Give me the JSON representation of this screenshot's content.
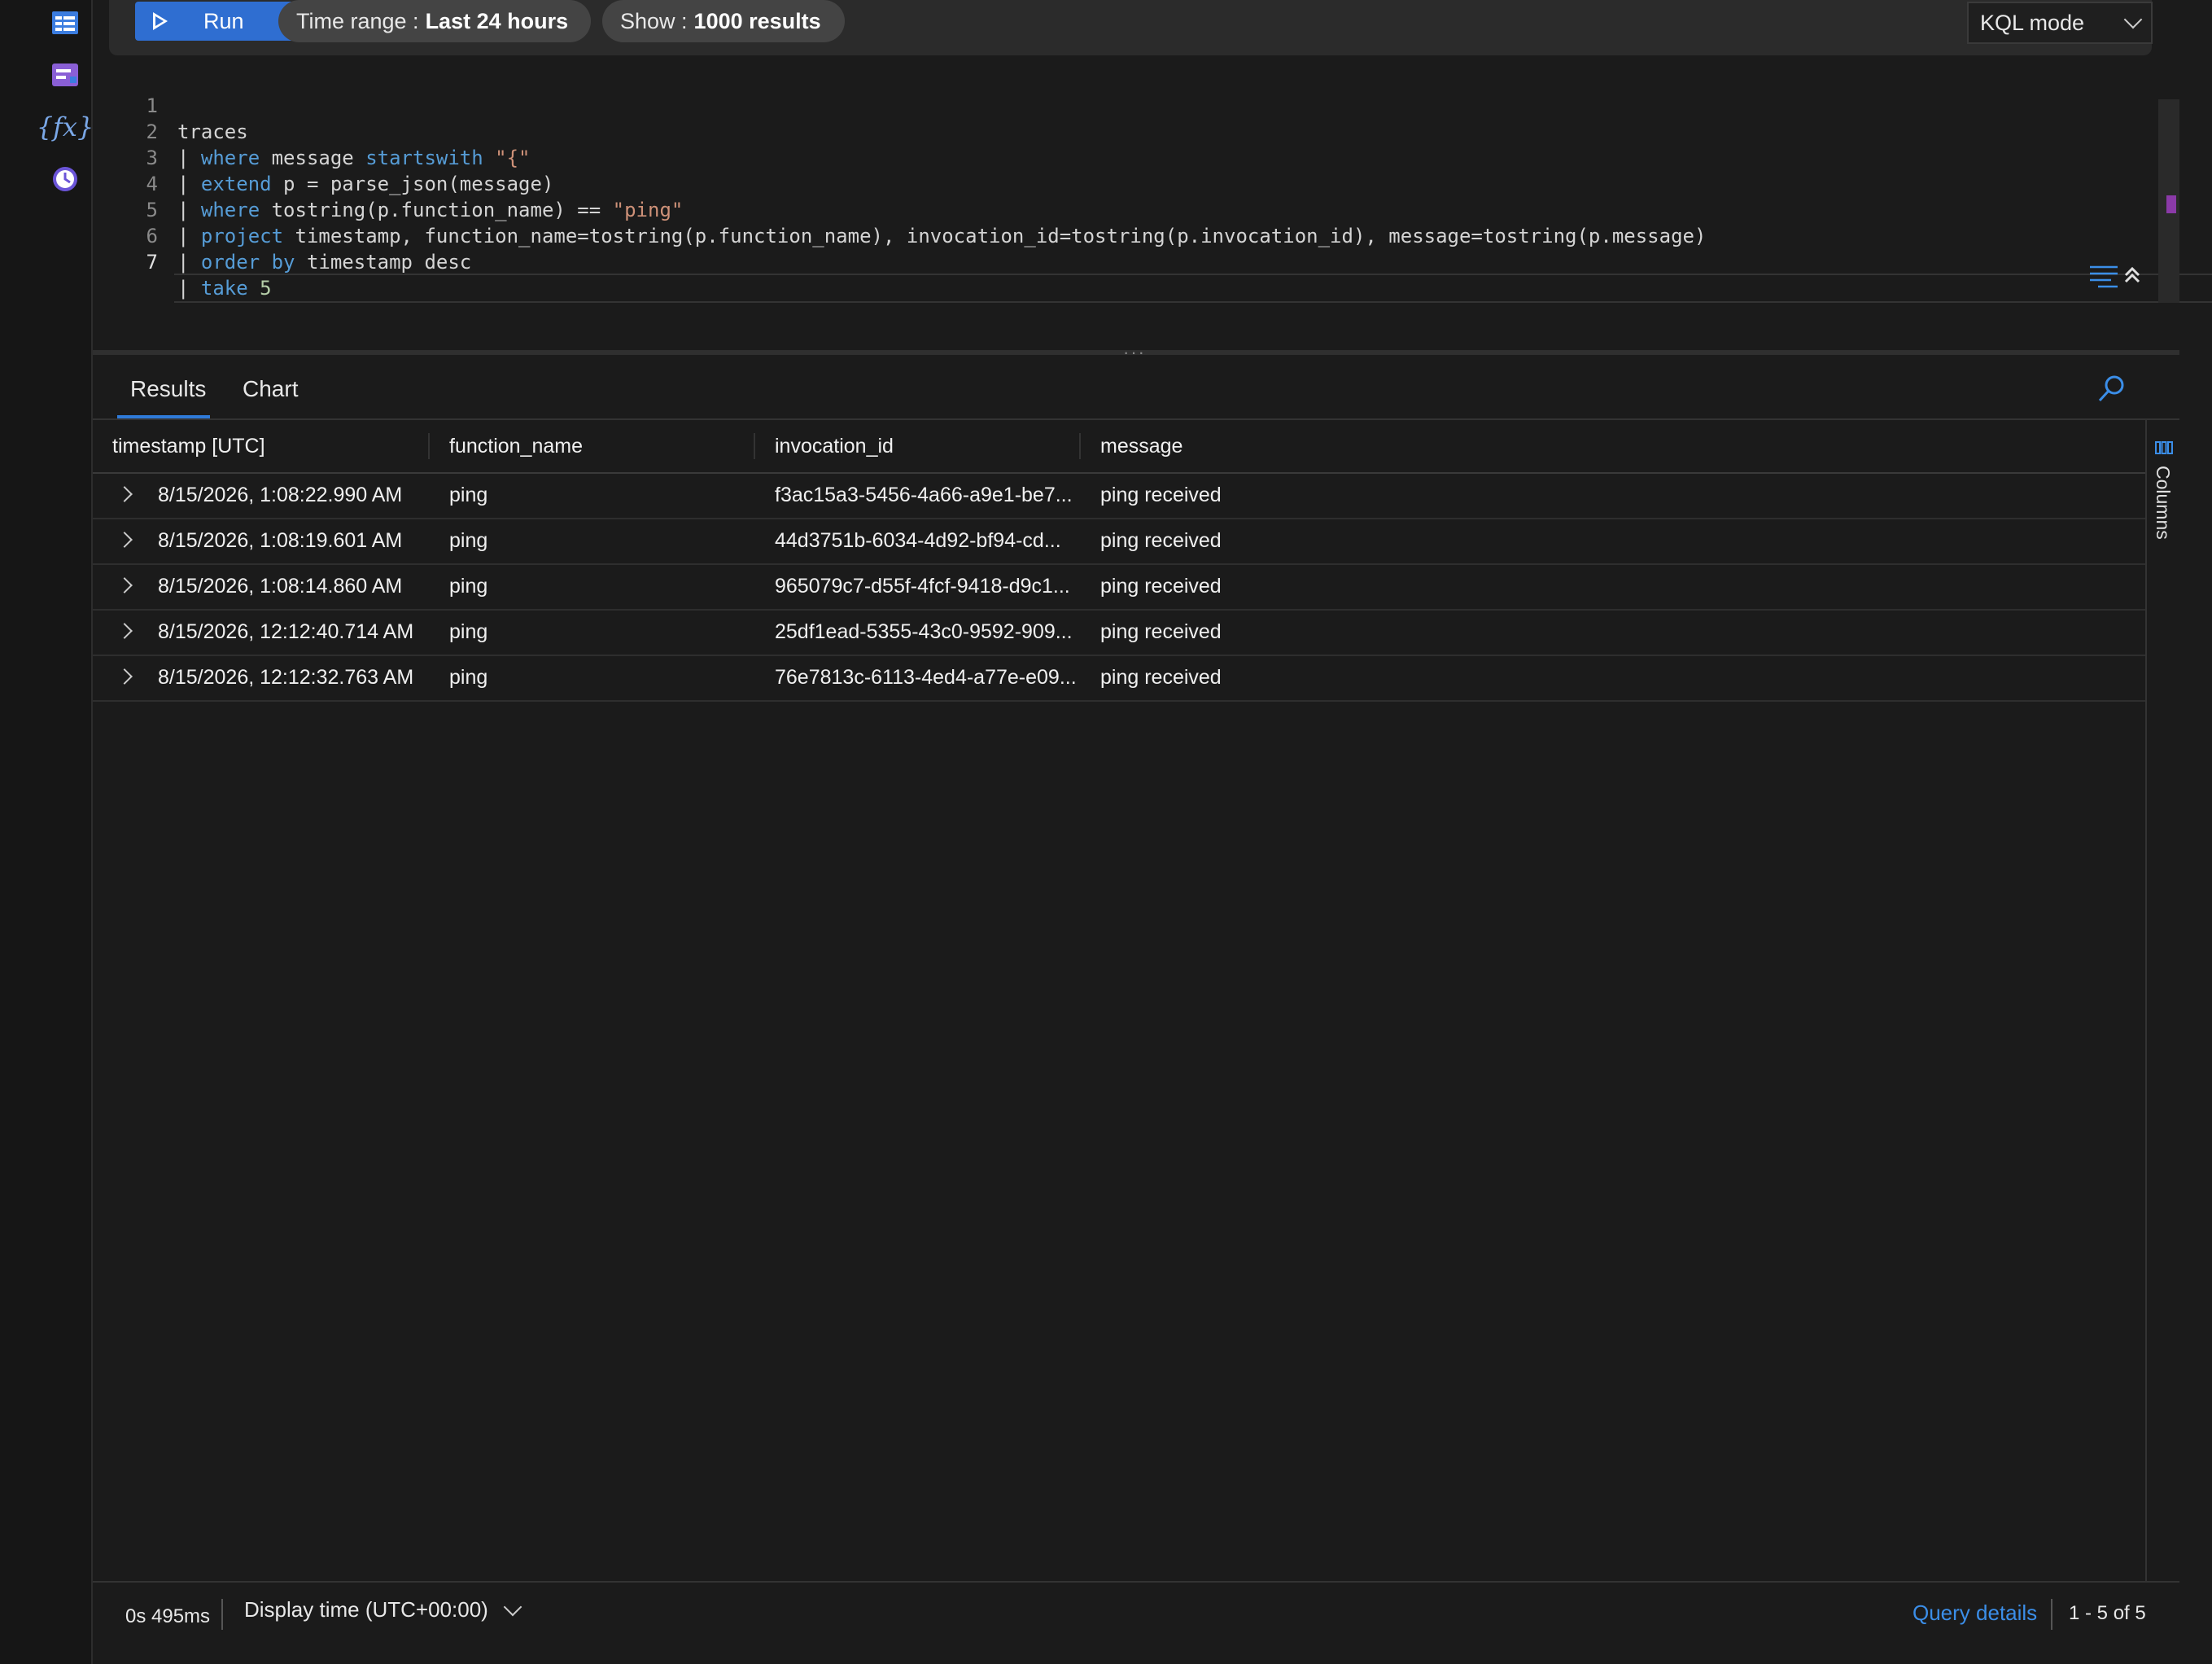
{
  "rail": {
    "icons": [
      "tables-icon",
      "queries-icon",
      "functions-icon",
      "history-icon"
    ],
    "fx_glyph": "{fx}"
  },
  "toolbar": {
    "run_label": "Run",
    "time_range_label": "Time range :",
    "time_range_value": "Last 24 hours",
    "show_label": "Show :",
    "show_value": "1000 results",
    "mode_label": "KQL mode"
  },
  "editor": {
    "active_line": 7,
    "lines": [
      {
        "n": "1",
        "text": "traces"
      },
      {
        "n": "2",
        "text": "| where message startswith \"{\""
      },
      {
        "n": "3",
        "text": "| extend p = parse_json(message)"
      },
      {
        "n": "4",
        "text": "| where tostring(p.function_name) == \"ping\""
      },
      {
        "n": "5",
        "text": "| project timestamp, function_name=tostring(p.function_name), invocation_id=tostring(p.invocation_id), message=tostring(p.message)"
      },
      {
        "n": "6",
        "text": "| order by timestamp desc"
      },
      {
        "n": "7",
        "text": "| take 5"
      }
    ]
  },
  "tabs": {
    "results": "Results",
    "chart": "Chart"
  },
  "grid": {
    "columns": [
      "timestamp [UTC]",
      "function_name",
      "invocation_id",
      "message"
    ],
    "rows": [
      [
        "8/15/2026, 1:08:22.990 AM",
        "ping",
        "f3ac15a3-5456-4a66-a9e1-be7...",
        "ping received"
      ],
      [
        "8/15/2026, 1:08:19.601 AM",
        "ping",
        "44d3751b-6034-4d92-bf94-cd...",
        "ping received"
      ],
      [
        "8/15/2026, 1:08:14.860 AM",
        "ping",
        "965079c7-d55f-4fcf-9418-d9c1...",
        "ping received"
      ],
      [
        "8/15/2026, 12:12:40.714 AM",
        "ping",
        "25df1ead-5355-43c0-9592-909...",
        "ping received"
      ],
      [
        "8/15/2026, 12:12:32.763 AM",
        "ping",
        "76e7813c-6113-4ed4-a77e-e09...",
        "ping received"
      ]
    ]
  },
  "columns_panel": {
    "label": "Columns"
  },
  "footer": {
    "duration": "0s 495ms",
    "display_time": "Display time (UTC+00:00)",
    "query_details": "Query details",
    "count": "1 - 5 of 5"
  },
  "colors": {
    "accent": "#2f6ed1",
    "link": "#3b8ee8",
    "keyword": "#569cd6",
    "string": "#ce9178",
    "number": "#b5cea8"
  }
}
